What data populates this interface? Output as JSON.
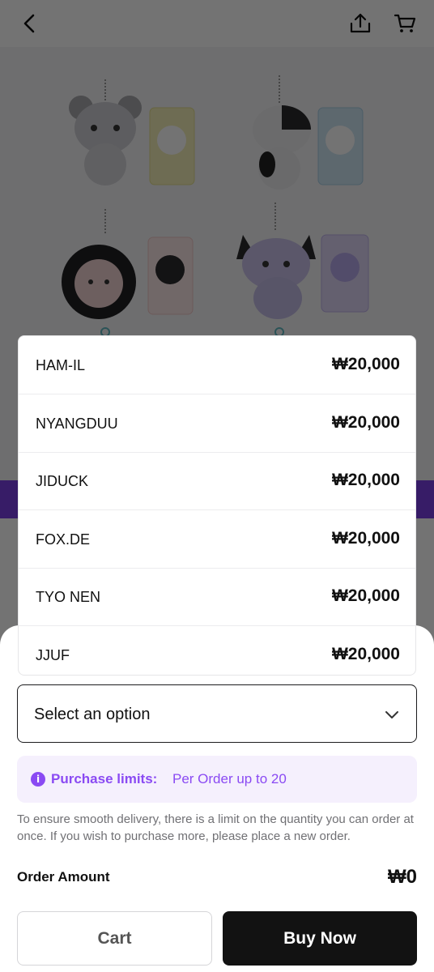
{
  "header": {
    "back_icon": "chevron-left-icon",
    "share_icon": "share-icon",
    "cart_icon": "cart-icon"
  },
  "options": [
    {
      "name": "HAM-IL",
      "price": "₩20,000"
    },
    {
      "name": "NYANGDUU",
      "price": "₩20,000"
    },
    {
      "name": "JIDUCK",
      "price": "₩20,000"
    },
    {
      "name": "FOX.DE",
      "price": "₩20,000"
    },
    {
      "name": "TYO NEN",
      "price": "₩20,000"
    },
    {
      "name": "JJUF",
      "price": "₩20,000"
    }
  ],
  "select": {
    "placeholder": "Select an option",
    "icon": "chevron-down-icon"
  },
  "limits": {
    "label": "Purchase limits:",
    "value": "Per Order up to 20",
    "icon": "info-icon"
  },
  "note": "To ensure smooth delivery, there is a limit on the quantity you can order at once. If you wish to purchase more, please place a new order.",
  "order": {
    "label": "Order Amount",
    "amount": "₩0"
  },
  "buttons": {
    "cart": "Cart",
    "buy": "Buy Now"
  },
  "colors": {
    "accent": "#8a4af3",
    "strip": "#7b3fe4",
    "primary_button": "#121212"
  }
}
